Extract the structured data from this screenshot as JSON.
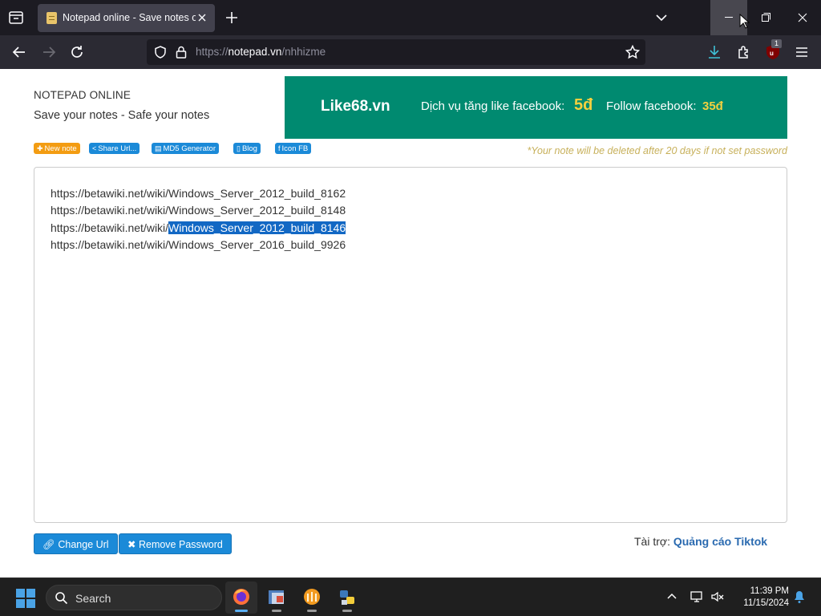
{
  "browser": {
    "tab_title": "Notepad online - Save notes on",
    "url_prefix": "https://",
    "url_host": "notepad.vn",
    "url_path": "/nhhizme",
    "extension_badge": "1"
  },
  "page": {
    "site_title": "NOTEPAD ONLINE",
    "tagline": "Save your notes - Safe your notes",
    "ad": {
      "brand": "Like68.vn",
      "text1": "Dịch vụ tăng like facebook:",
      "price1": "5đ",
      "text2": "Follow facebook:",
      "price2": "35đ"
    },
    "toolbar": {
      "new_note": "New note",
      "share_url": "Share Url...",
      "md5": "MD5 Generator",
      "blog": "Blog",
      "icon_fb": "Icon FB"
    },
    "notice": "*Your note will be deleted after 20 days if not set password",
    "note_lines": [
      "https://betawiki.net/wiki/Windows_Server_2012_build_8162",
      "https://betawiki.net/wiki/Windows_Server_2012_build_8148",
      "https://betawiki.net/wiki/Windows_Server_2012_build_8146",
      "https://betawiki.net/wiki/Windows_Server_2016_build_9926"
    ],
    "selected_line_prefix": "https://betawiki.net/wiki/",
    "selected_text": "Windows_Server_2012_build_8146",
    "change_url": "Change Url",
    "remove_password": "Remove Password",
    "sponsor_label": "Tài trợ:",
    "sponsor_link": "Quảng cáo Tiktok"
  },
  "taskbar": {
    "search_label": "Search",
    "time": "11:39 PM",
    "date": "11/15/2024"
  },
  "colors": {
    "ad_background": "#008a70",
    "button_blue": "#1b8ad8",
    "selection": "#1268c4"
  }
}
